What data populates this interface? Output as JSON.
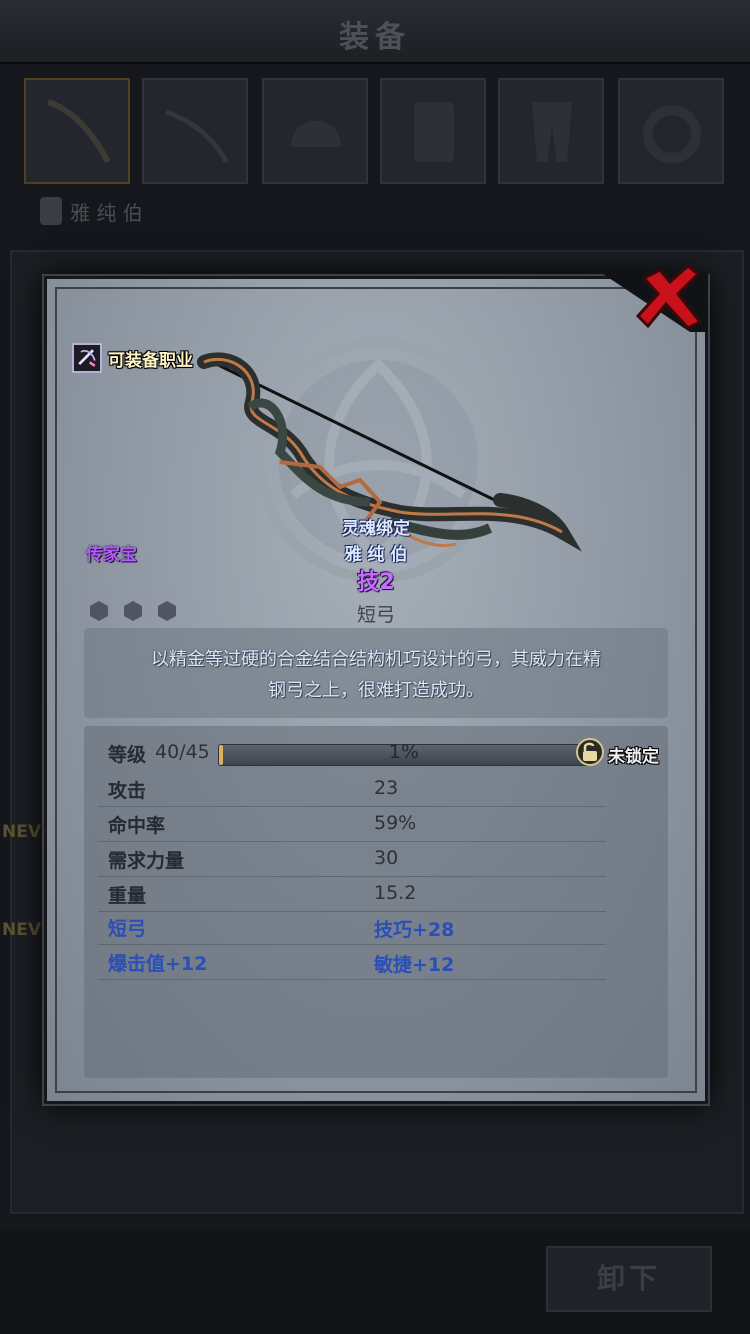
{
  "background": {
    "title": "装备",
    "character_name": "雅 纯 伯",
    "new_badges": [
      "NEV",
      "NEV"
    ],
    "unequip_label": "卸下"
  },
  "item": {
    "equip_class_label": "可装备职业",
    "rarity": "传家宝",
    "soulbound": "灵魂绑定",
    "owner": "雅 纯 伯",
    "skill": "技2",
    "type": "短弓",
    "sockets": 3,
    "description_line1": "以精金等过硬的合金结合结构机巧设计的弓，其威力在精",
    "description_line2": "钢弓之上，很难打造成功。",
    "level_label": "等级",
    "level_value": "40/45",
    "xp_percent": 1,
    "xp_text": "1%",
    "lock_label": "未锁定",
    "stats": [
      {
        "label": "攻击",
        "value": "23"
      },
      {
        "label": "命中率",
        "value": "59%"
      },
      {
        "label": "需求力量",
        "value": "30"
      },
      {
        "label": "重量",
        "value": "15.2"
      }
    ],
    "bonuses": [
      {
        "label": "短弓",
        "value": "技巧+28"
      },
      {
        "label": "爆击值+12",
        "value": "敏捷+12"
      }
    ]
  },
  "colors": {
    "rarity": "#b05cff",
    "skill": "#c56dff",
    "bonus": "#2a4fb6",
    "close": "#c8111a"
  }
}
